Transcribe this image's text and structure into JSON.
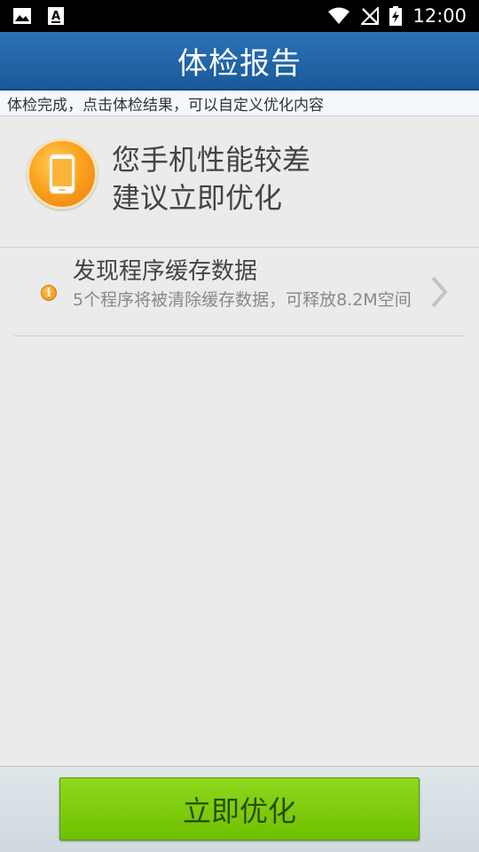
{
  "status_bar": {
    "time": "12:00",
    "icons": [
      "image-icon",
      "font-icon",
      "wifi-icon",
      "no-signal-icon",
      "battery-charging-icon"
    ]
  },
  "header": {
    "title": "体检报告"
  },
  "hint": {
    "text": "体检完成，点击体检结果，可以自定义优化内容"
  },
  "summary": {
    "line1": "您手机性能较差",
    "line2": "建议立即优化",
    "icon": "phone-icon"
  },
  "result_item": {
    "title": "发现程序缓存数据",
    "description": "5个程序将被清除缓存数据，可释放8.2M空间",
    "icon": "info-icon",
    "chevron": "chevron-right-icon"
  },
  "actions": {
    "optimize_label": "立即优化"
  },
  "colors": {
    "title_bar": "#1f65a8",
    "button": "#7cc80c",
    "accent_orange": "#f59a18"
  }
}
